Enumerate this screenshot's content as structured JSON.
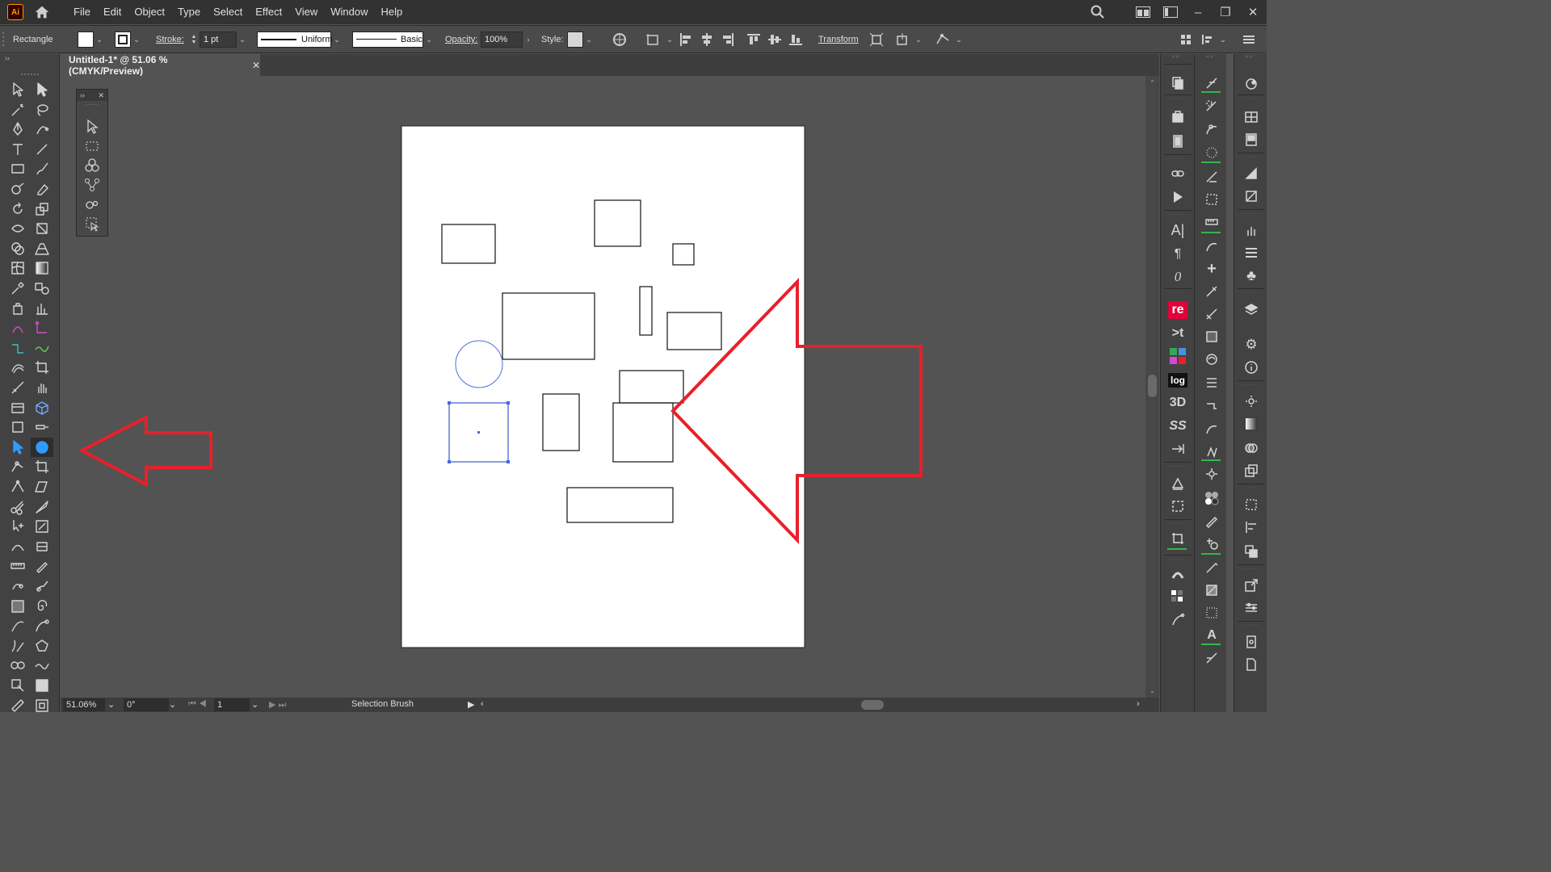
{
  "app": {
    "logo_text": "Ai"
  },
  "menu": [
    "File",
    "Edit",
    "Object",
    "Type",
    "Select",
    "Effect",
    "View",
    "Window",
    "Help"
  ],
  "control_bar": {
    "selection_type": "Rectangle",
    "stroke_label": "Stroke:",
    "stroke_weight": "1 pt",
    "stroke_profile": "Uniform",
    "brush": "Basic",
    "opacity_label": "Opacity:",
    "opacity_value": "100%",
    "style_label": "Style:",
    "transform_label": "Transform"
  },
  "document": {
    "tab_title": "Untitled-1* @ 51.06 % (CMYK/Preview)",
    "close_glyph": "✕"
  },
  "status_bar": {
    "zoom": "51.06%",
    "rotation": "0°",
    "artboard": "1",
    "current_tool": "Selection Brush"
  },
  "right_dock": {
    "re_label": "re",
    "log_label": "log",
    "text_3d": "3D",
    "ss_label": "SS",
    "t_label": ">t"
  },
  "colors": {
    "annotation_arrow": "#e8202a",
    "selection": "#4169e1",
    "artboard": "#ffffff",
    "pasteboard": "#535353",
    "active_tool": "#2f9bff"
  }
}
